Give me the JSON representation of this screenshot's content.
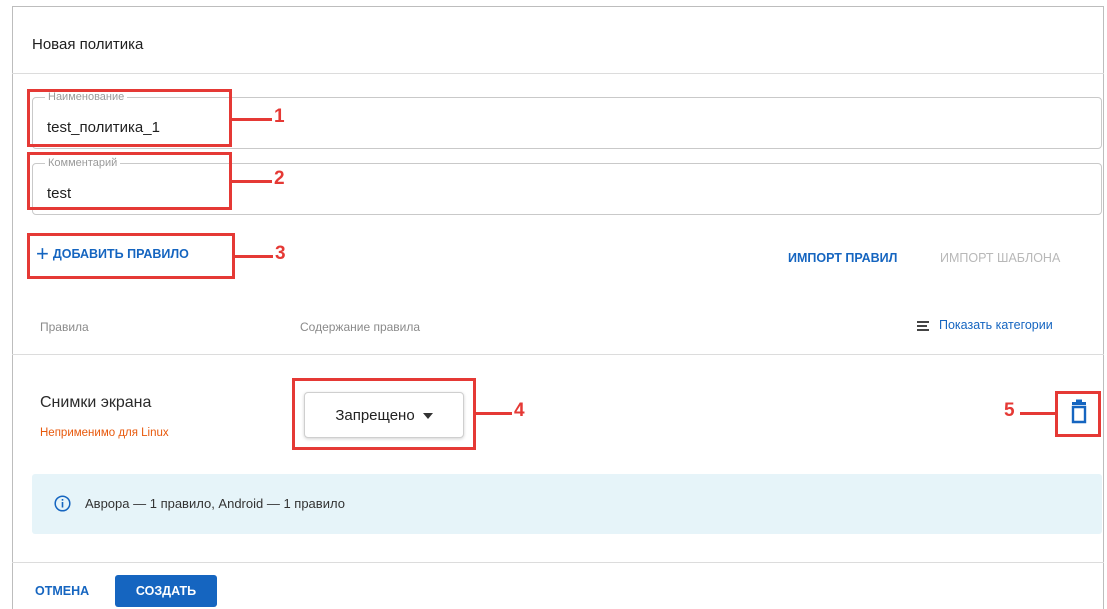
{
  "dialog": {
    "title": "Новая политика"
  },
  "form": {
    "name": {
      "legend": "Наименование",
      "value": "test_политика_1"
    },
    "comment": {
      "legend": "Комментарий",
      "value": "test"
    }
  },
  "actions": {
    "add_rule_label": "ДОБАВИТЬ ПРАВИЛО",
    "import_rules_label": "ИМПОРТ ПРАВИЛ",
    "import_template_label": "ИМПОРТ ШАБЛОНА"
  },
  "table": {
    "col_rules": "Правила",
    "col_content": "Содержание правила",
    "show_categories": "Показать категории",
    "rows": [
      {
        "name": "Снимки экрана",
        "warning": "Неприменимо для Linux",
        "value": "Запрещено"
      }
    ]
  },
  "info": {
    "text": "Аврора — 1 правило, Android — 1 правило"
  },
  "footer": {
    "cancel_label": "ОТМЕНА",
    "create_label": "СОЗДАТЬ"
  },
  "annotations": {
    "n1": "1",
    "n2": "2",
    "n3": "3",
    "n4": "4",
    "n5": "5"
  },
  "colors": {
    "accent": "#1565c0",
    "warning": "#e8590c",
    "annotation": "#e53935",
    "info_bg": "#e6f4f9"
  },
  "icons": {
    "add": "plus-icon",
    "categories": "list-lines-icon",
    "select": "caret-down-icon",
    "delete": "trash-icon",
    "info": "info-circle-icon"
  }
}
